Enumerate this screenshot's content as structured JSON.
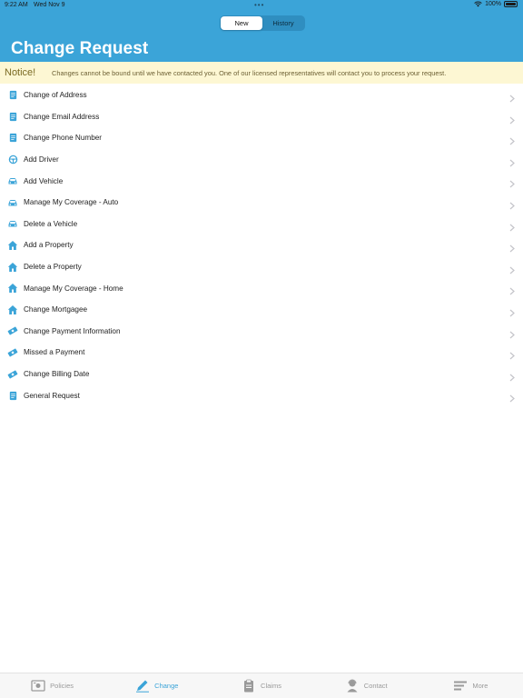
{
  "status_bar": {
    "time": "9:22 AM",
    "date": "Wed Nov 9",
    "battery": "100%"
  },
  "segments": [
    "New",
    "History"
  ],
  "page_title": "Change Request",
  "notice": {
    "label": "Notice!",
    "text": "Changes cannot be bound until we have contacted you. One of our licensed representatives will contact you to process your request."
  },
  "items": [
    {
      "label": "Change of Address",
      "icon": "document-icon"
    },
    {
      "label": "Change Email Address",
      "icon": "document-icon"
    },
    {
      "label": "Change Phone Number",
      "icon": "document-icon"
    },
    {
      "label": "Add Driver",
      "icon": "steering-wheel-icon"
    },
    {
      "label": "Add Vehicle",
      "icon": "car-icon"
    },
    {
      "label": "Manage My Coverage - Auto",
      "icon": "car-icon"
    },
    {
      "label": "Delete a Vehicle",
      "icon": "car-icon"
    },
    {
      "label": "Add a Property",
      "icon": "house-icon"
    },
    {
      "label": "Delete a Property",
      "icon": "house-icon"
    },
    {
      "label": "Manage My Coverage - Home",
      "icon": "house-icon"
    },
    {
      "label": "Change Mortgagee",
      "icon": "house-icon"
    },
    {
      "label": "Change Payment Information",
      "icon": "money-icon"
    },
    {
      "label": "Missed a Payment",
      "icon": "money-icon"
    },
    {
      "label": "Change Billing Date",
      "icon": "money-icon"
    },
    {
      "label": "General Request",
      "icon": "document-icon"
    }
  ],
  "tabs": [
    {
      "label": "Policies",
      "icon": "policies-icon"
    },
    {
      "label": "Change",
      "icon": "pencil-icon"
    },
    {
      "label": "Claims",
      "icon": "clipboard-icon"
    },
    {
      "label": "Contact",
      "icon": "agent-icon"
    },
    {
      "label": "More",
      "icon": "menu-icon"
    }
  ],
  "colors": {
    "accent": "#3ba4d8",
    "notice_bg": "#fdf7d3",
    "inactive_tab": "#9a9a9a"
  }
}
